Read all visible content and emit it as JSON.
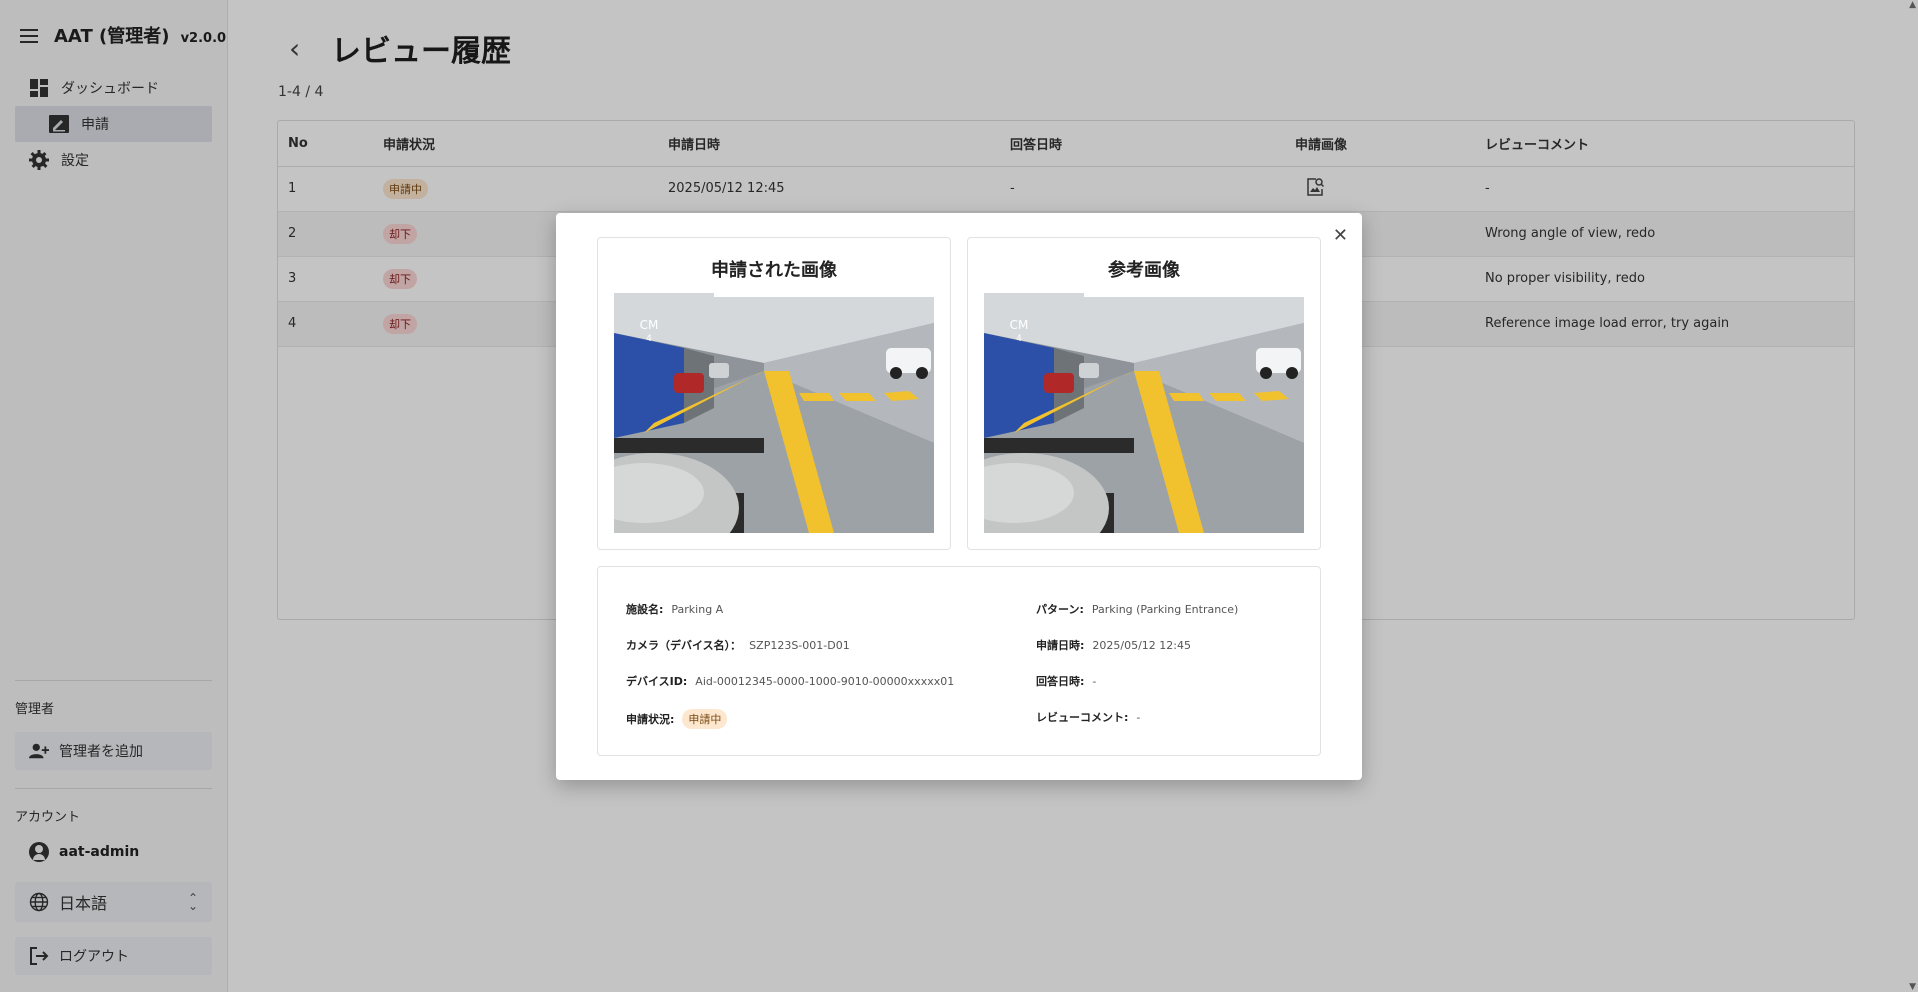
{
  "app": {
    "title": "AAT (管理者)",
    "version": "v2.0.0"
  },
  "sidebar": {
    "items": [
      {
        "label": "ダッシュボード"
      },
      {
        "label": "申請"
      },
      {
        "label": "設定"
      }
    ],
    "admin_section": "管理者",
    "add_admin": "管理者を追加",
    "account_section": "アカウント",
    "username": "aat-admin",
    "language": "日本語",
    "logout": "ログアウト"
  },
  "page": {
    "title": "レビュー履歴",
    "count": "1-4 / 4"
  },
  "table": {
    "headers": [
      "No",
      "申請状況",
      "申請日時",
      "回答日時",
      "申請画像",
      "レビューコメント"
    ],
    "rows": [
      {
        "no": "1",
        "status": "申請中",
        "applied": "2025/05/12 12:45",
        "answered": "-",
        "comment": "-"
      },
      {
        "no": "2",
        "status": "却下",
        "comment": "Wrong angle of view, redo"
      },
      {
        "no": "3",
        "status": "却下",
        "comment": "No proper visibility, redo"
      },
      {
        "no": "4",
        "status": "却下",
        "comment": "Reference image load error, try again"
      }
    ]
  },
  "modal": {
    "submitted_title": "申請された画像",
    "reference_title": "参考画像",
    "sign_text": "CM",
    "sign_num": "4",
    "info": {
      "facility_label": "施設名:",
      "facility_value": "Parking A",
      "camera_label": "カメラ（デバイス名）：",
      "camera_value": "SZP123S-001-D01",
      "device_label": "デバイスID:",
      "device_value": "Aid-00012345-0000-1000-9010-00000xxxxx01",
      "status_label": "申請状況:",
      "status_value": "申請中",
      "pattern_label": "パターン:",
      "pattern_value": "Parking (Parking Entrance)",
      "applied_label": "申請日時:",
      "applied_value": "2025/05/12 12:45",
      "answered_label": "回答日時:",
      "answered_value": "-",
      "comment_label": "レビューコメント:",
      "comment_value": "-"
    }
  },
  "colors": {
    "accent_blue": "#2c4fa8",
    "pending_bg": "#fde7cf",
    "rejected_bg": "#fbd6d6",
    "lane_yellow": "#f2c12e"
  }
}
